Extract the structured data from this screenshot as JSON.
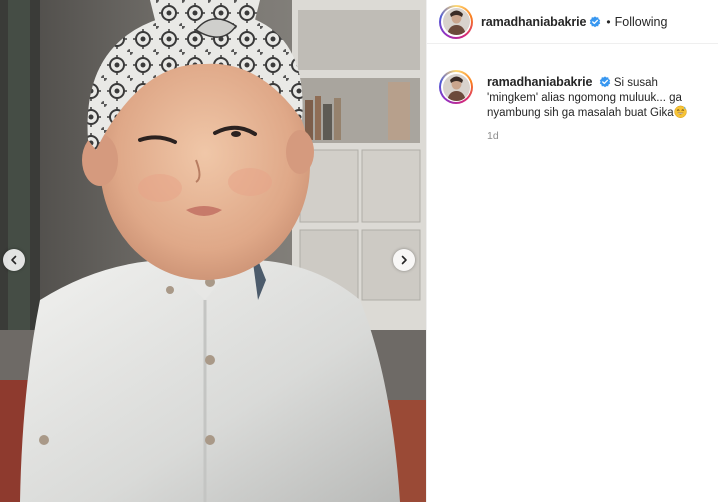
{
  "post": {
    "author": {
      "username": "ramadhaniabakrie",
      "verified": true,
      "avatar": "profile-photo",
      "verified_icon": "verified-badge-icon",
      "verified_color": "#3897f0"
    },
    "follow_status": "Following",
    "separator": "•",
    "caption": {
      "username": "ramadhaniabakrie",
      "text": "Si susah 'mingkem' alias ngomong muluuk... ga nyambung sih ga masalah buat Gika",
      "emoji": "smiling-face-with-sweat-emoji"
    },
    "timestamp": "1d",
    "media": {
      "image": "photo of a young boy wearing a white patterned head wrap and a white button-up shirt",
      "prev_icon": "chevron-left-icon",
      "next_icon": "chevron-right-icon"
    }
  }
}
